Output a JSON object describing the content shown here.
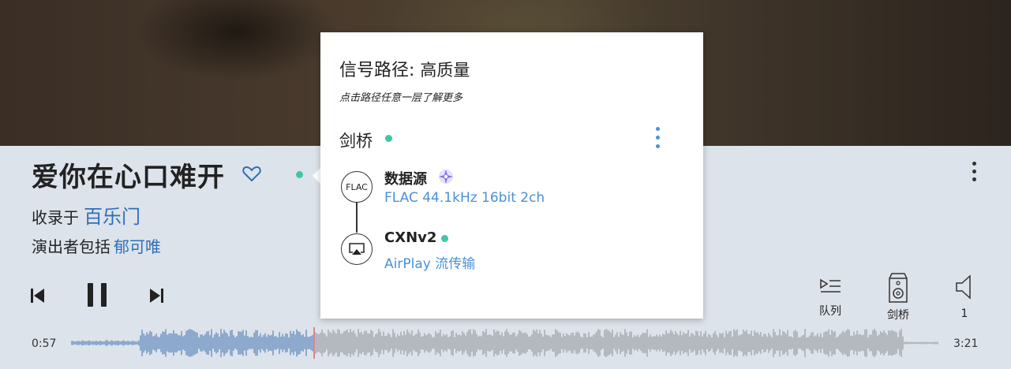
{
  "track": {
    "title": "爱你在心口难开",
    "album_prefix": "收录于",
    "album": "百乐门",
    "artist_prefix": "演出者包括",
    "artist": "郁可唯"
  },
  "playback": {
    "elapsed": "0:57",
    "duration": "3:21",
    "progress_fraction": 0.28
  },
  "bottom_controls": {
    "queue_label": "队列",
    "zone_label": "剑桥",
    "volume_label": "1"
  },
  "signal_popup": {
    "title": "信号路径:",
    "quality": "高质量",
    "subtitle": "点击路径任意一层了解更多",
    "zone_name": "剑桥",
    "nodes": [
      {
        "icon": "flac-icon",
        "icon_text": "FLAC",
        "name": "数据源",
        "detail": "FLAC 44.1kHz 16bit 2ch"
      },
      {
        "icon": "airplay-icon",
        "name": "CXNv2",
        "detail": "AirPlay 流传输"
      }
    ]
  },
  "colors": {
    "accent": "#2f6fb8",
    "link_light": "#4a90d9",
    "status_green": "#3cc8a8",
    "waveform_played": "#3d6fb0",
    "waveform_unplayed": "#8a8f96",
    "playhead": "#e04848"
  }
}
